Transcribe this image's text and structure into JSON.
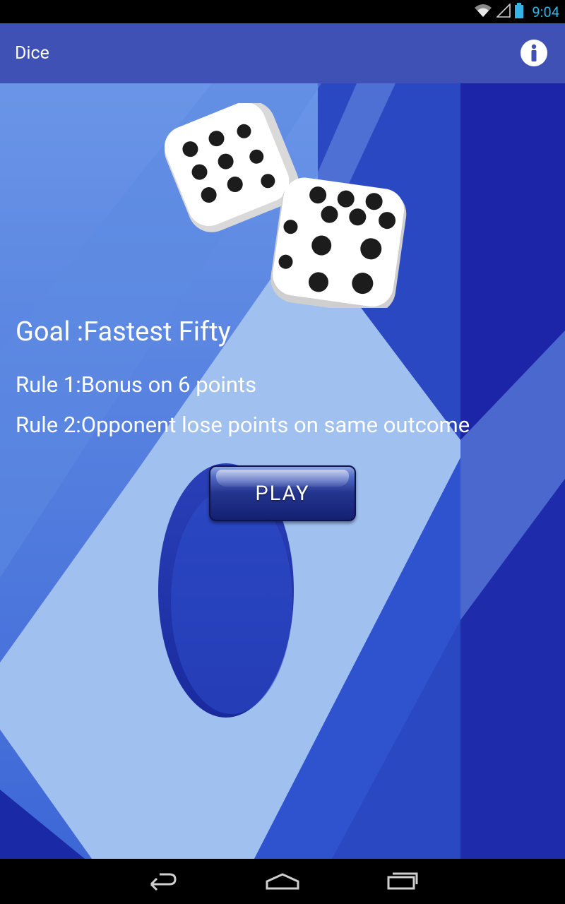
{
  "status_bar": {
    "time": "9:04",
    "icons": [
      "wifi-icon",
      "signal-icon",
      "battery-icon"
    ]
  },
  "app_bar": {
    "title": "Dice",
    "info_icon": "info-icon"
  },
  "content": {
    "goal": "Goal :Fastest Fifty",
    "rules": [
      "Rule 1:Bonus on 6 points",
      "Rule 2:Opponent lose points on same outcome"
    ],
    "play_label": "PLAY"
  },
  "nav_bar": {
    "icons": [
      "back-icon",
      "home-icon",
      "recents-icon"
    ]
  },
  "colors": {
    "app_bar": "#3f51b5",
    "status_accent": "#33b5e5",
    "background_light": "#8fb3ee",
    "background_dark": "#1c25a8"
  }
}
